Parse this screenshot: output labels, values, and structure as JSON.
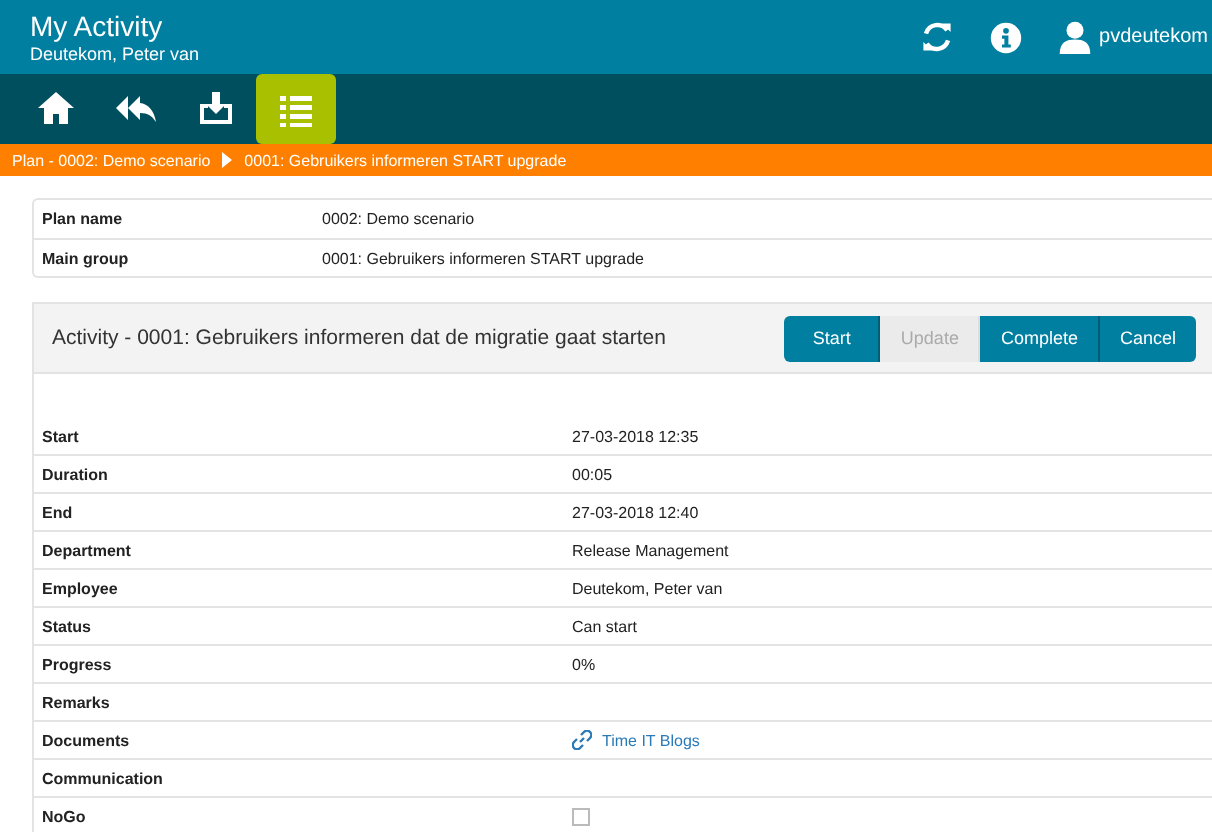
{
  "header": {
    "title": "My Activity",
    "subtitle": "Deutekom, Peter van",
    "user": "pvdeutekom"
  },
  "nav": [
    {
      "kind": "home",
      "selected": false
    },
    {
      "kind": "reply",
      "selected": false
    },
    {
      "kind": "inbox",
      "selected": false
    },
    {
      "kind": "list",
      "selected": true
    }
  ],
  "breadcrumb": [
    "Plan - 0002: Demo scenario",
    "0001: Gebruikers informeren START upgrade"
  ],
  "info": [
    {
      "label": "Plan name",
      "value": "0002: Demo scenario"
    },
    {
      "label": "Main group",
      "value": "0001: Gebruikers informeren START upgrade"
    }
  ],
  "activity": {
    "title": "Activity - 0001: Gebruikers informeren dat de migratie gaat starten",
    "buttons": [
      {
        "label": "Start",
        "disabled": false
      },
      {
        "label": "Update",
        "disabled": true
      },
      {
        "label": "Complete",
        "disabled": false
      },
      {
        "label": "Cancel",
        "disabled": false
      }
    ]
  },
  "details": [
    {
      "kind": "text",
      "label": "Start",
      "value": "27-03-2018 12:35"
    },
    {
      "kind": "text",
      "label": "Duration",
      "value": "00:05"
    },
    {
      "kind": "text",
      "label": "End",
      "value": "27-03-2018 12:40"
    },
    {
      "kind": "text",
      "label": "Department",
      "value": "Release Management"
    },
    {
      "kind": "text",
      "label": "Employee",
      "value": "Deutekom, Peter van"
    },
    {
      "kind": "text",
      "label": "Status",
      "value": "Can start"
    },
    {
      "kind": "text",
      "label": "Progress",
      "value": "0%"
    },
    {
      "kind": "text",
      "label": "Remarks"
    },
    {
      "kind": "link",
      "label": "Documents",
      "value": "Time IT Blogs"
    },
    {
      "kind": "text",
      "label": "Communication"
    },
    {
      "kind": "checkbox",
      "label": "NoGo",
      "checked": false
    }
  ]
}
